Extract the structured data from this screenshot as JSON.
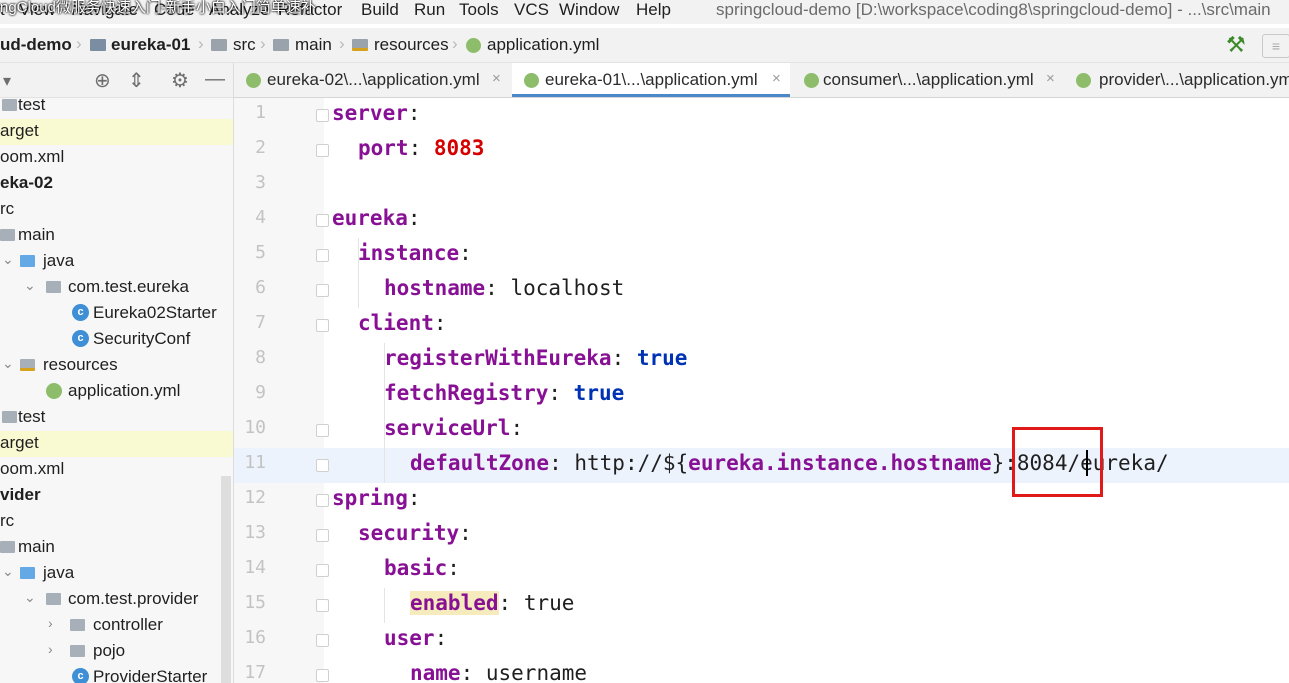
{
  "menubar": {
    "items": [
      "t",
      "View",
      "Navigate",
      "Code",
      "Analyze",
      "Refactor",
      "Build",
      "Run",
      "Tools",
      "VCS",
      "Window",
      "Help"
    ],
    "overlay_text": "ngCloud微服务快速入门-新手小白入门简单速补",
    "window_title": "springcloud-demo [D:\\workspace\\coding8\\springcloud-demo] - ...\\src\\main"
  },
  "breadcrumb": {
    "items": [
      "ud-demo",
      "eureka-01",
      "src",
      "main",
      "resources",
      "application.yml"
    ]
  },
  "tabs": [
    {
      "label": "eureka-02\\...\\application.yml",
      "active": false
    },
    {
      "label": "eureka-01\\...\\application.yml",
      "active": true
    },
    {
      "label": "consumer\\...\\application.yml",
      "active": false
    },
    {
      "label": "provider\\...\\application.yml",
      "active": false
    }
  ],
  "tree": [
    {
      "label": "test",
      "icon": "folder",
      "bold": false,
      "highlight": false
    },
    {
      "label": "arget",
      "icon": "none",
      "bold": false,
      "highlight": true
    },
    {
      "label": "oom.xml",
      "icon": "none",
      "bold": false,
      "highlight": false
    },
    {
      "label": "eka-02",
      "icon": "none",
      "bold": true,
      "highlight": false
    },
    {
      "label": "rc",
      "icon": "none",
      "bold": false,
      "highlight": false
    },
    {
      "label": "main",
      "icon": "folder",
      "bold": false,
      "highlight": false
    },
    {
      "label": "java",
      "icon": "src-folder",
      "bold": false,
      "highlight": false
    },
    {
      "label": "com.test.eureka",
      "icon": "folder",
      "bold": false,
      "highlight": false
    },
    {
      "label": "Eureka02Starter",
      "icon": "class",
      "bold": false,
      "highlight": false
    },
    {
      "label": "SecurityConf",
      "icon": "class",
      "bold": false,
      "highlight": false
    },
    {
      "label": "resources",
      "icon": "res-folder",
      "bold": false,
      "highlight": false
    },
    {
      "label": "application.yml",
      "icon": "yml",
      "bold": false,
      "highlight": false
    },
    {
      "label": "test",
      "icon": "folder",
      "bold": false,
      "highlight": false
    },
    {
      "label": "arget",
      "icon": "none",
      "bold": false,
      "highlight": true
    },
    {
      "label": "oom.xml",
      "icon": "none",
      "bold": false,
      "highlight": false
    },
    {
      "label": "vider",
      "icon": "none",
      "bold": true,
      "highlight": false
    },
    {
      "label": "rc",
      "icon": "none",
      "bold": false,
      "highlight": false
    },
    {
      "label": "main",
      "icon": "folder",
      "bold": false,
      "highlight": false
    },
    {
      "label": "java",
      "icon": "src-folder",
      "bold": false,
      "highlight": false
    },
    {
      "label": "com.test.provider",
      "icon": "folder",
      "bold": false,
      "highlight": false
    },
    {
      "label": "controller",
      "icon": "folder",
      "bold": false,
      "highlight": false
    },
    {
      "label": "pojo",
      "icon": "folder",
      "bold": false,
      "highlight": false
    },
    {
      "label": "ProviderStarter",
      "icon": "class",
      "bold": false,
      "highlight": false
    }
  ],
  "code": [
    {
      "n": "1",
      "k": "server",
      "sep": ":",
      "v": "",
      "vt": "plain"
    },
    {
      "n": "2",
      "k": "port",
      "sep": ": ",
      "v": "8083",
      "vt": "num"
    },
    {
      "n": "3",
      "k": "",
      "sep": "",
      "v": "",
      "vt": "plain"
    },
    {
      "n": "4",
      "k": "eureka",
      "sep": ":",
      "v": "",
      "vt": "plain"
    },
    {
      "n": "5",
      "k": "instance",
      "sep": ":",
      "v": "",
      "vt": "plain"
    },
    {
      "n": "6",
      "k": "hostname",
      "sep": ": ",
      "v": "localhost",
      "vt": "plain"
    },
    {
      "n": "7",
      "k": "client",
      "sep": ":",
      "v": "",
      "vt": "plain"
    },
    {
      "n": "8",
      "k": "registerWithEureka",
      "sep": ": ",
      "v": "true",
      "vt": "bool"
    },
    {
      "n": "9",
      "k": "fetchRegistry",
      "sep": ": ",
      "v": "true",
      "vt": "bool"
    },
    {
      "n": "10",
      "k": "serviceUrl",
      "sep": ":",
      "v": "",
      "vt": "plain"
    },
    {
      "n": "11",
      "k": "defaultZone",
      "sep": ": ",
      "v": "http://${",
      "vt": "plain",
      "v2": "eureka.instance.hostname",
      "v3": "}:8084/eureka/"
    },
    {
      "n": "12",
      "k": "spring",
      "sep": ":",
      "v": "",
      "vt": "plain"
    },
    {
      "n": "13",
      "k": "security",
      "sep": ":",
      "v": "",
      "vt": "plain"
    },
    {
      "n": "14",
      "k": "basic",
      "sep": ":",
      "v": "",
      "vt": "plain"
    },
    {
      "n": "15",
      "k": "enabled",
      "sep": ": ",
      "v": "true",
      "vt": "plain"
    },
    {
      "n": "16",
      "k": "user",
      "sep": ":",
      "v": "",
      "vt": "plain"
    },
    {
      "n": "17",
      "k": "name",
      "sep": ": ",
      "v": "username",
      "vt": "plain"
    }
  ],
  "colors": {
    "keyword": "#871094",
    "number": "#d50000",
    "highlight_box": "#e01919",
    "current_line": "#edf3fd"
  }
}
